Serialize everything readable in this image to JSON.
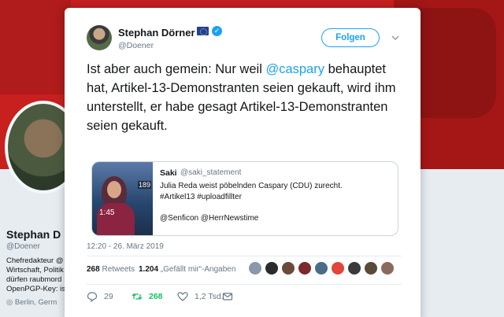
{
  "profile": {
    "name": "Stephan D",
    "handle": "@Doener",
    "bio_lines": [
      "Chefredakteur @",
      "Wirtschaft, Politik",
      "dürfen raubmord",
      "OpenPGP-Key: is"
    ],
    "location": "◎ Berlin, Germ"
  },
  "tweet": {
    "author_name": "Stephan Dörner",
    "author_handle": "@Doener",
    "follow_label": "Folgen",
    "text_before": "Ist aber auch gemein: Nur weil ",
    "mention": "@caspary",
    "text_after": " behauptet hat, Artikel-13-Demonstranten seien gekauft, wird ihm unterstellt, er habe gesagt Artikel-13-Demonstranten seien gekauft.",
    "timestamp": "12:20 - 26. März 2019",
    "retweet_count": "268",
    "retweet_label": "Retweets",
    "like_count": "1.204",
    "like_label": "„Gefällt mir“-Angaben",
    "reply_action_count": "29",
    "retweet_action_count": "268",
    "like_action_count": "1,2 Tsd."
  },
  "quoted": {
    "name": "Saki",
    "handle": "@saki_statement",
    "lines": [
      "Julia Reda weist pöbelnden Caspary (CDU) zurecht.",
      "#Artikel13 #uploadfillter",
      "",
      "@Senficon @HerrNewstime"
    ],
    "media_label": "189",
    "video_duration": "1:45"
  },
  "colors": {
    "accent": "#1da1f2",
    "retweet_green": "#17bf63",
    "header_red": "#c81f1f",
    "liker_colors": [
      "#8a98a8",
      "#2b2b2b",
      "#6b4a3a",
      "#7a2a2a",
      "#4a6b8a",
      "#e0463b",
      "#3a3a3a",
      "#5a4a3a",
      "#8a6a5a"
    ]
  },
  "icons": [
    "verified-icon",
    "eu-flag-icon",
    "caret-down-icon",
    "reply-icon",
    "retweet-icon",
    "like-icon",
    "direct-message-icon"
  ]
}
